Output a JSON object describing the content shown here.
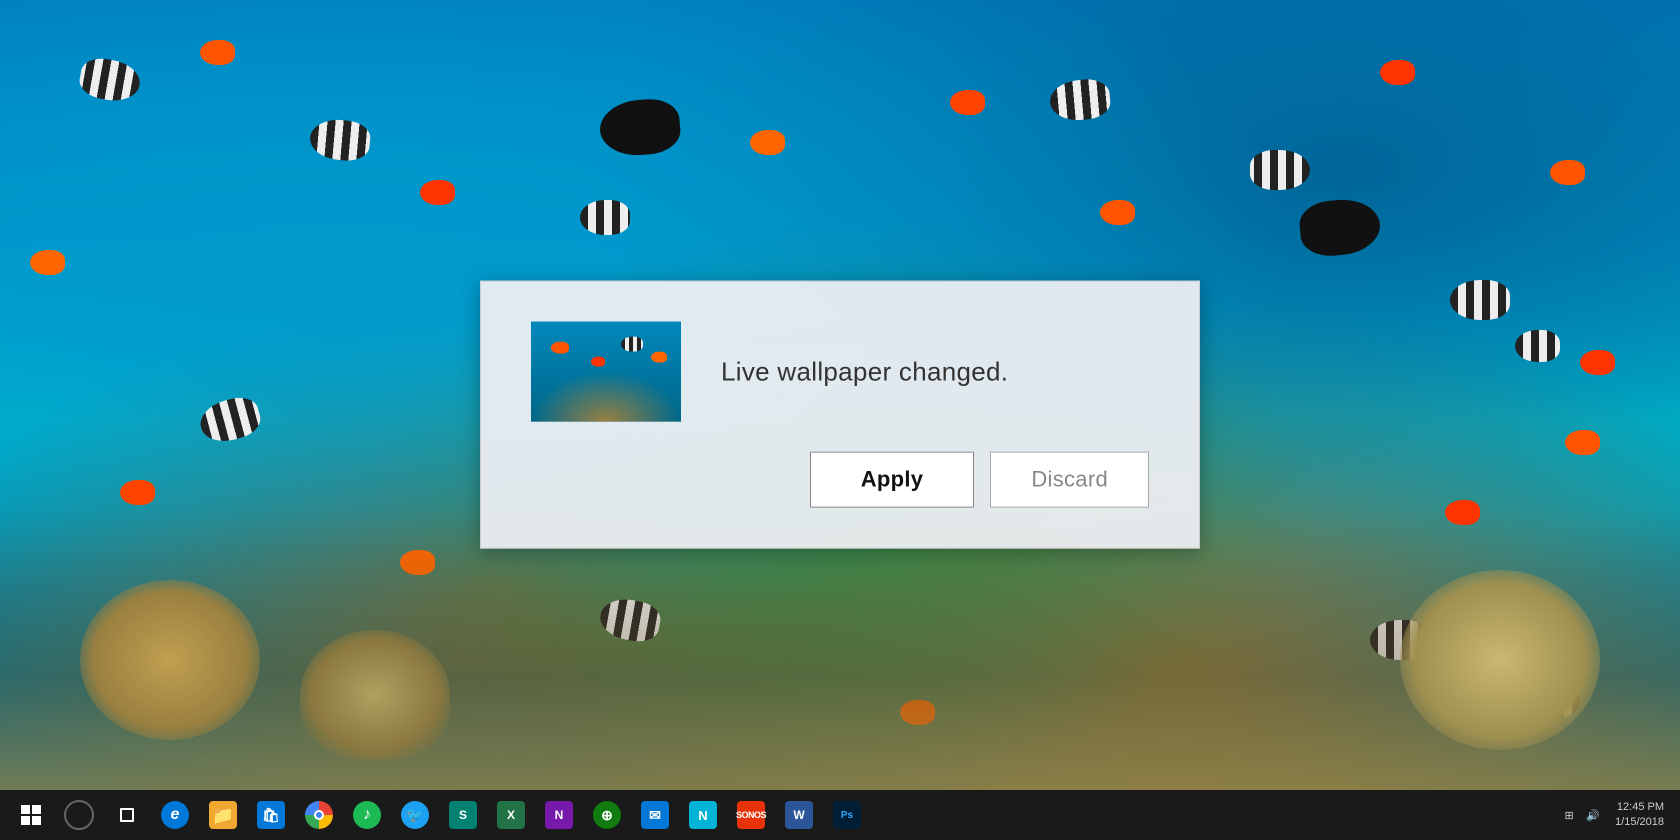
{
  "desktop": {
    "background_desc": "Underwater coral reef with colorful fish"
  },
  "dialog": {
    "message": "Live wallpaper changed.",
    "apply_label": "Apply",
    "discard_label": "Discard",
    "thumbnail_alt": "Underwater reef wallpaper preview"
  },
  "taskbar": {
    "items": [
      {
        "id": "start",
        "label": "Start",
        "icon": "windows-logo-icon"
      },
      {
        "id": "cortana",
        "label": "Cortana",
        "icon": "cortana-search-icon"
      },
      {
        "id": "taskview",
        "label": "Task View",
        "icon": "task-view-icon"
      },
      {
        "id": "edge",
        "label": "Microsoft Edge",
        "icon": "edge-icon",
        "color": "#0078d7"
      },
      {
        "id": "files",
        "label": "File Explorer",
        "icon": "folder-icon",
        "color": "#f0a830"
      },
      {
        "id": "store",
        "label": "Microsoft Store",
        "icon": "store-icon",
        "color": "#0078d7"
      },
      {
        "id": "chrome",
        "label": "Google Chrome",
        "icon": "chrome-icon"
      },
      {
        "id": "spotify",
        "label": "Spotify",
        "icon": "spotify-icon",
        "color": "#1db954"
      },
      {
        "id": "twitter",
        "label": "Twitter",
        "icon": "twitter-icon",
        "color": "#1da1f2"
      },
      {
        "id": "sway",
        "label": "Sway",
        "icon": "sway-icon",
        "color": "#008272"
      },
      {
        "id": "excel",
        "label": "Excel",
        "icon": "excel-icon",
        "color": "#217346"
      },
      {
        "id": "onenote",
        "label": "OneNote",
        "icon": "onenote-icon",
        "color": "#7719aa"
      },
      {
        "id": "xbox",
        "label": "Xbox",
        "icon": "xbox-icon",
        "color": "#107c10"
      },
      {
        "id": "mail",
        "label": "Mail",
        "icon": "mail-icon",
        "color": "#0078d7"
      },
      {
        "id": "newnote",
        "label": "Sticky Notes",
        "icon": "note-icon",
        "color": "#00b4d8"
      },
      {
        "id": "sonos",
        "label": "Sonos",
        "icon": "sonos-icon",
        "color": "#e8320a"
      },
      {
        "id": "word",
        "label": "Word",
        "icon": "word-icon",
        "color": "#2b579a"
      },
      {
        "id": "photoshop",
        "label": "Photoshop",
        "icon": "photoshop-icon",
        "color": "#001e36"
      }
    ],
    "clock": {
      "time": "12:45 PM",
      "date": "1/15/2018"
    }
  }
}
